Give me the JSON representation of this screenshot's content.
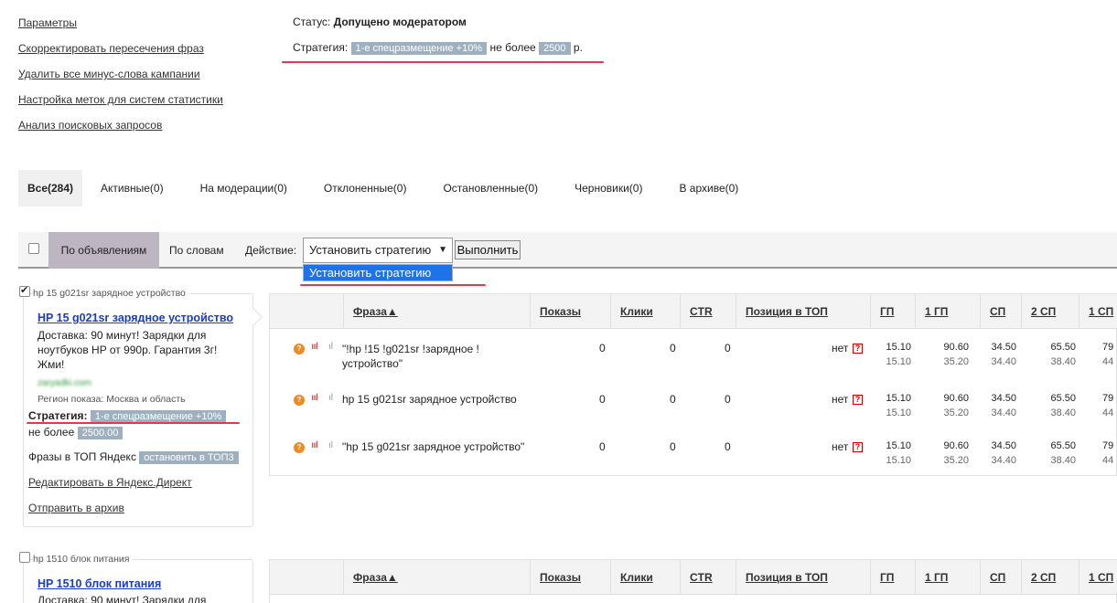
{
  "sidebar_links": [
    "Параметры",
    "Скорректировать пересечения фраз",
    "Удалить все минус-слова кампании",
    "Настройка меток для систем статистики",
    "Анализ поисковых запросов"
  ],
  "status": {
    "label": "Статус:",
    "value": "Допущено модератором"
  },
  "strategy": {
    "label": "Стратегия:",
    "badge": "1-е спецразмещение +10%",
    "middle": "не более",
    "amount": "2500",
    "currency": "р."
  },
  "tabs": [
    "Все(284)",
    "Активные(0)",
    "На модерации(0)",
    "Отклоненные(0)",
    "Остановленные(0)",
    "Черновики(0)",
    "В архиве(0)"
  ],
  "toolbar": {
    "by_ads": "По объявлениям",
    "by_words": "По словам",
    "action_label": "Действие:",
    "select_value": "Установить стратегию",
    "select_arrow": "▼",
    "execute": "Выполнить",
    "dropdown_option": "Установить стратегию"
  },
  "columns": [
    "Фраза▲",
    "Показы",
    "Клики",
    "CTR",
    "Позиция в ТОП",
    "ГП",
    "1 ГП",
    "СП",
    "2 СП",
    "1 СП"
  ],
  "ad1": {
    "group_title": "hp 15 g021sr зарядное устройство",
    "title": "HP 15 g021sr зарядное устройство",
    "text": "Доставка: 90 минут! Зарядки для ноутбуков HP от 990р. Гарантия 3г! Жми!",
    "domain": "zaryadki.com",
    "region": "Регион показа: Москва и область",
    "strategy_label": "Стратегия:",
    "strategy_badge": "1-е спецразмещение +10%",
    "limit_label": "не более",
    "limit_value": "2500.00",
    "top_label": "Фразы в ТОП Яндекс",
    "top_badge": "остановить в ТОП3",
    "edit_link": "Редактировать в Яндекс.Директ",
    "archive_link": "Отправить в архив",
    "rows": [
      {
        "phrase": "\"!hp !15 !g021sr !зарядное !",
        "phrase2": "устройство\"",
        "shows": "0",
        "clicks": "0",
        "ctr": "0",
        "pos": "нет",
        "gp": [
          "15.10",
          "15.10"
        ],
        "gp1": [
          "90.60",
          "35.20"
        ],
        "sp": [
          "34.50",
          "34.40"
        ],
        "sp2": [
          "65.50",
          "38.40"
        ],
        "sp1": [
          "79",
          "44"
        ]
      },
      {
        "phrase": "hp 15 g021sr зарядное устройство",
        "phrase2": "",
        "shows": "0",
        "clicks": "0",
        "ctr": "0",
        "pos": "нет",
        "gp": [
          "15.10",
          "15.10"
        ],
        "gp1": [
          "90.60",
          "35.20"
        ],
        "sp": [
          "34.50",
          "34.40"
        ],
        "sp2": [
          "65.50",
          "38.40"
        ],
        "sp1": [
          "79",
          "44"
        ]
      },
      {
        "phrase": "\"hp 15 g021sr зарядное устройство\"",
        "phrase2": "",
        "shows": "0",
        "clicks": "0",
        "ctr": "0",
        "pos": "нет",
        "gp": [
          "15.10",
          "15.10"
        ],
        "gp1": [
          "90.60",
          "35.20"
        ],
        "sp": [
          "34.50",
          "34.40"
        ],
        "sp2": [
          "65.50",
          "38.40"
        ],
        "sp1": [
          "79",
          "44"
        ]
      }
    ]
  },
  "ad2": {
    "group_title": "hp 1510 блок питания",
    "title": "HP 1510 блок питания",
    "text": "Доставка: 90 минут! Зарядки для"
  },
  "icons": {
    "orange": "info-circle-icon",
    "bars_red": "bars-red-icon",
    "bars_gray": "bars-gray-icon",
    "question": "question-icon"
  }
}
